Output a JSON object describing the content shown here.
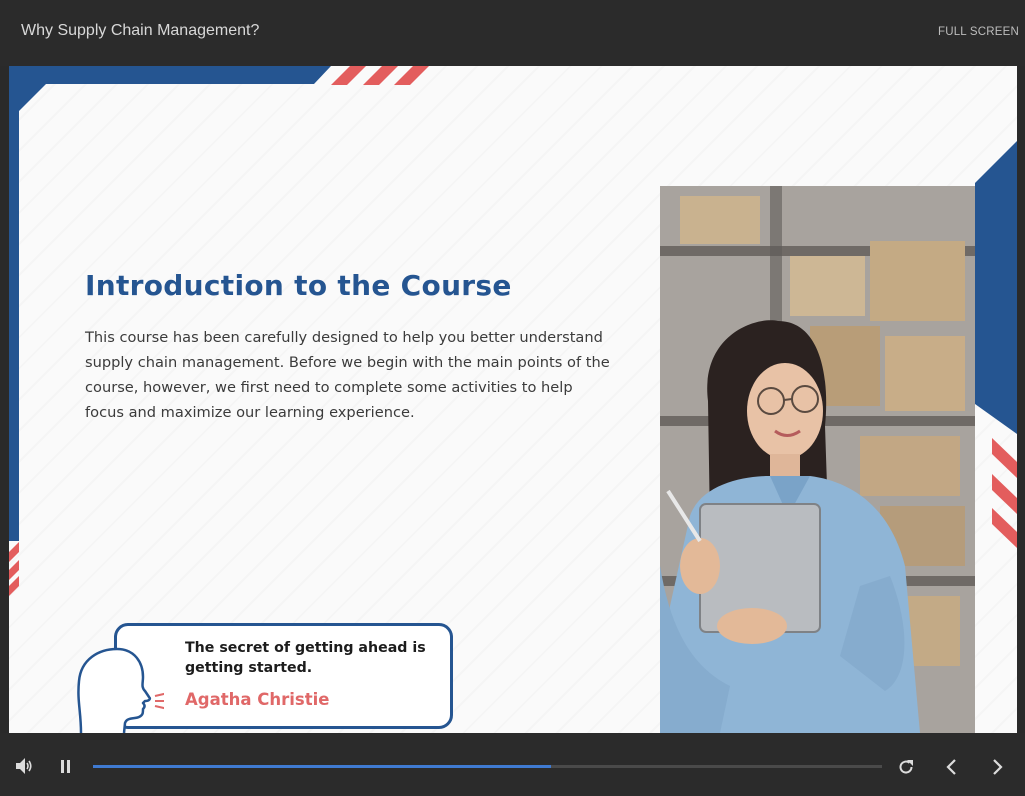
{
  "header": {
    "title": "Why Supply Chain Management?",
    "fullscreen_label": "FULL SCREEN"
  },
  "slide": {
    "heading": "Introduction to the Course",
    "body": "This course has been carefully designed to help you better understand supply chain management. Before we begin with the main points of the course, however, we first need to complete some activities to help focus and maximize our learning experience.",
    "quote": "The secret of getting ahead is getting started.",
    "author": "Agatha Christie"
  },
  "player": {
    "progress": 0.58,
    "icons": [
      "volume-icon",
      "pause-icon",
      "replay-icon",
      "previous-icon",
      "next-icon"
    ]
  },
  "colors": {
    "primary_blue": "#255591",
    "accent_red": "#e06868",
    "progress_blue": "#3f7ad1",
    "chrome": "#2b2b2b"
  }
}
